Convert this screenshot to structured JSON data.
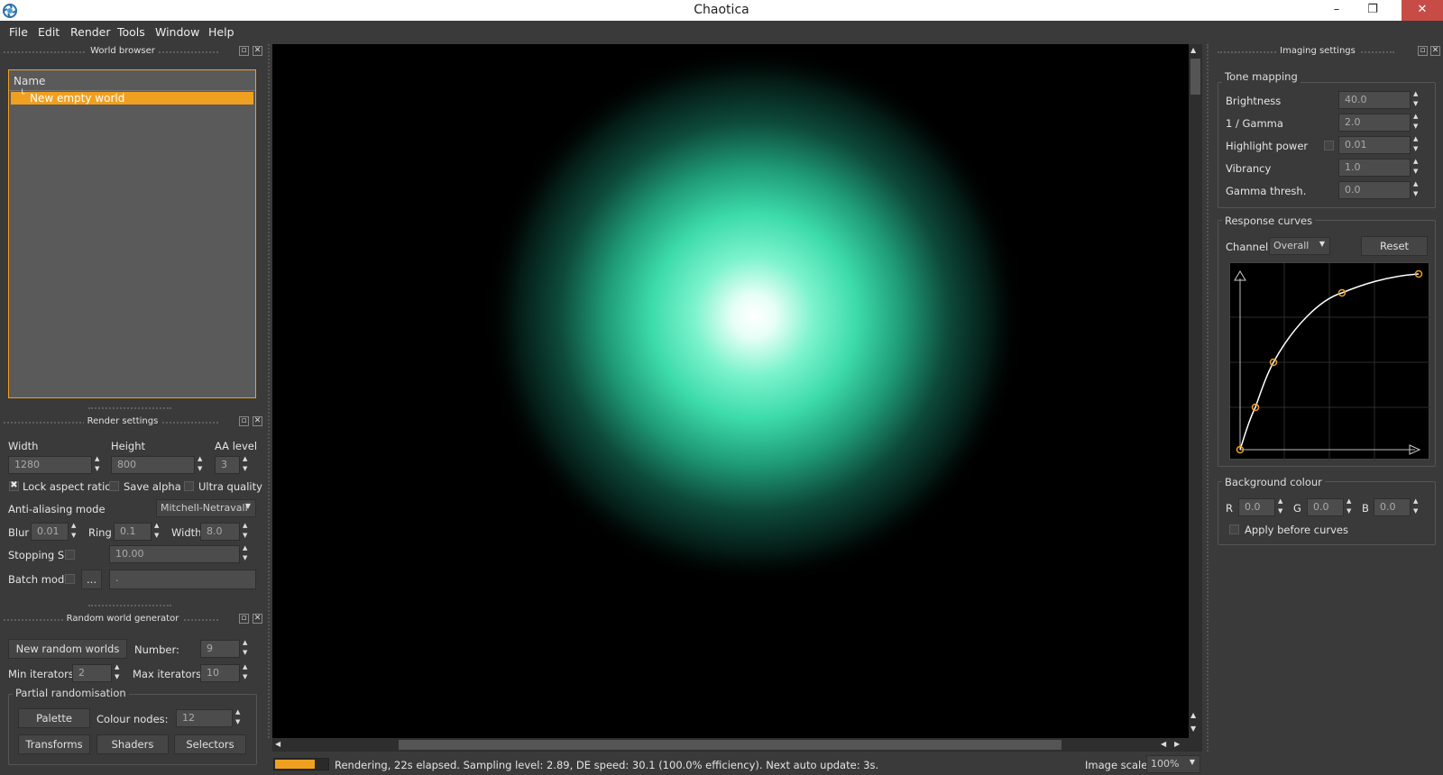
{
  "window": {
    "title": "Chaotica",
    "minimize": "–",
    "restore": "❐",
    "close": "✕"
  },
  "menu": [
    "File",
    "Edit",
    "Render",
    "Tools",
    "Window",
    "Help"
  ],
  "world_browser": {
    "title": "World browser",
    "column": "Name",
    "items": [
      "New empty world"
    ]
  },
  "render_settings": {
    "title": "Render settings",
    "width_label": "Width",
    "height_label": "Height",
    "aa_label": "AA level",
    "width": "1280",
    "height": "800",
    "aa": "3",
    "lock_aspect": "Lock aspect ratio",
    "save_alpha": "Save alpha",
    "ultra_quality": "Ultra quality",
    "aa_mode_label": "Anti-aliasing mode",
    "aa_mode": "Mitchell-Netravali",
    "blur_label": "Blur",
    "blur": "0.01",
    "ring_label": "Ring",
    "ring": "0.1",
    "width2_label": "Width",
    "width2": "8.0",
    "stopping_label": "Stopping SL",
    "stopping": "10.00",
    "batch_label": "Batch mode",
    "batch_btn": "...",
    "batch_path": "."
  },
  "random_gen": {
    "title": "Random world generator",
    "new_btn": "New random worlds",
    "number_label": "Number:",
    "number": "9",
    "min_label": "Min iterators:",
    "min": "2",
    "max_label": "Max iterators:",
    "max": "10",
    "partial_label": "Partial randomisation",
    "palette_btn": "Palette",
    "colour_nodes_label": "Colour nodes:",
    "colour_nodes": "12",
    "transforms_btn": "Transforms",
    "shaders_btn": "Shaders",
    "selectors_btn": "Selectors"
  },
  "imaging": {
    "title": "Imaging settings",
    "tone_label": "Tone mapping",
    "brightness_label": "Brightness",
    "brightness": "40.0",
    "gamma_label": "1 / Gamma",
    "gamma": "2.0",
    "highlight_label": "Highlight power",
    "highlight": "0.01",
    "vibrancy_label": "Vibrancy",
    "vibrancy": "1.0",
    "gthresh_label": "Gamma thresh.",
    "gthresh": "0.0",
    "curves_label": "Response curves",
    "channel_label": "Channel:",
    "channel": "Overall",
    "reset_btn": "Reset",
    "bg_label": "Background colour",
    "r_label": "R",
    "r": "0.0",
    "g_label": "G",
    "g": "0.0",
    "b_label": "B",
    "b": "0.0",
    "apply_label": "Apply before curves"
  },
  "status": {
    "text": "Rendering, 22s elapsed. Sampling level: 2.89, DE speed: 30.1 (100.0% efficiency). Next auto update: 3s.",
    "progress": 0.75,
    "scale_label": "Image scale:",
    "scale": "100%"
  },
  "colors": {
    "accent": "#f0a020",
    "glow": "#3ee8b0",
    "background": "#3a3a3a"
  }
}
